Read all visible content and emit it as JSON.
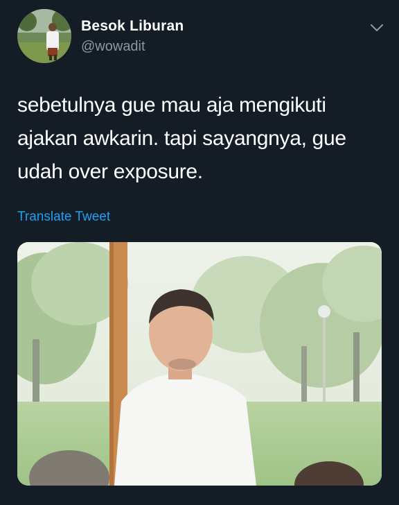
{
  "tweet": {
    "author_name": "Besok Liburan",
    "author_handle": "@wowadit",
    "text_lines": [
      "sebetulnya gue mau aja mengikuti",
      "ajakan awkarin. tapi sayangnya, gue",
      "udah over exposure."
    ],
    "translate_label": "Translate Tweet"
  },
  "icons": {
    "menu": "chevron-down-icon"
  },
  "colors": {
    "background": "#141d26",
    "text": "#ffffff",
    "secondary_text": "#8899a6",
    "link": "#1da1f2"
  }
}
